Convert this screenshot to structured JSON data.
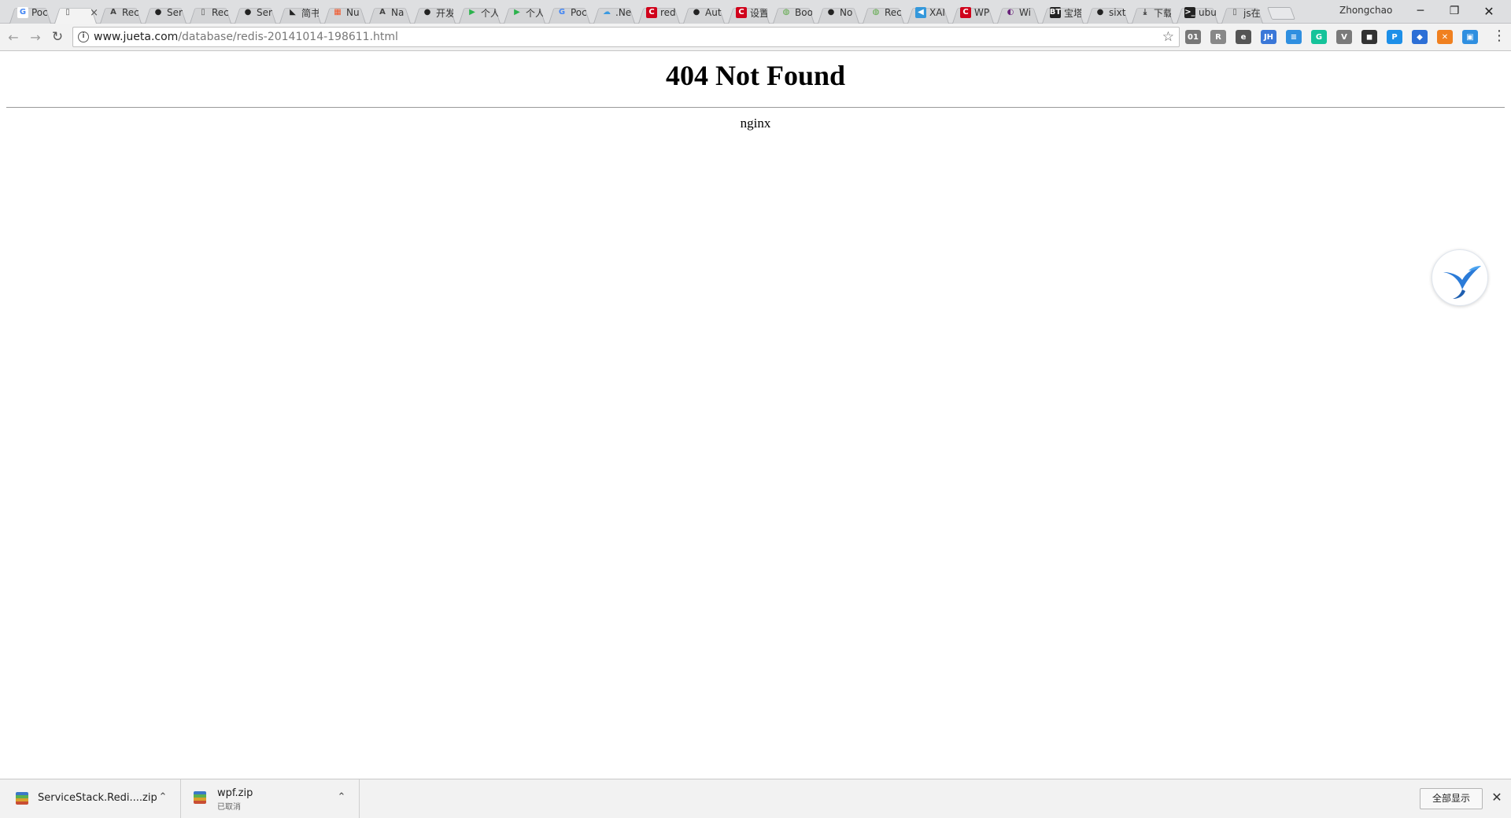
{
  "browser": {
    "tabs": [
      {
        "title": "Poc",
        "favicon": "google-icon",
        "fav_text": "G",
        "fav_color": "#ffffff",
        "fav_fg": "#4285f4",
        "active": false
      },
      {
        "title": "",
        "favicon": "page-icon",
        "fav_text": "▯",
        "fav_color": "transparent",
        "fav_fg": "#555555",
        "active": true,
        "close": "×"
      },
      {
        "title": "Rec",
        "favicon": "translate-icon",
        "fav_text": "A",
        "fav_color": "transparent",
        "fav_fg": "#444444",
        "active": false
      },
      {
        "title": "Ser",
        "favicon": "github-icon",
        "fav_text": "●",
        "fav_color": "transparent",
        "fav_fg": "#222222",
        "active": false
      },
      {
        "title": "Rec",
        "favicon": "page-icon",
        "fav_text": "▯",
        "fav_color": "transparent",
        "fav_fg": "#555555",
        "active": false
      },
      {
        "title": "Ser",
        "favicon": "github-icon",
        "fav_text": "●",
        "fav_color": "transparent",
        "fav_fg": "#222222",
        "active": false
      },
      {
        "title": "简书",
        "favicon": "jianshu-icon",
        "fav_text": "◣",
        "fav_color": "transparent",
        "fav_fg": "#222222",
        "active": false
      },
      {
        "title": "Nu",
        "favicon": "microsoft-icon",
        "fav_text": "▦",
        "fav_color": "transparent",
        "fav_fg": "#f35325",
        "active": false
      },
      {
        "title": "Na",
        "favicon": "translate-icon",
        "fav_text": "A",
        "fav_color": "transparent",
        "fav_fg": "#444444",
        "active": false
      },
      {
        "title": "开发",
        "favicon": "github-icon",
        "fav_text": "●",
        "fav_color": "transparent",
        "fav_fg": "#222222",
        "active": false
      },
      {
        "title": "个人",
        "favicon": "play-icon",
        "fav_text": "▶",
        "fav_color": "transparent",
        "fav_fg": "#2bb24c",
        "active": false
      },
      {
        "title": "个人",
        "favicon": "play-icon",
        "fav_text": "▶",
        "fav_color": "transparent",
        "fav_fg": "#2bb24c",
        "active": false
      },
      {
        "title": "Poc",
        "favicon": "google-icon",
        "fav_text": "G",
        "fav_color": "transparent",
        "fav_fg": "#4285f4",
        "active": false
      },
      {
        "title": ".Ne",
        "favicon": "cloud-icon",
        "fav_text": "☁",
        "fav_color": "transparent",
        "fav_fg": "#3b9ae1",
        "active": false
      },
      {
        "title": "red",
        "favicon": "csdn-icon",
        "fav_text": "C",
        "fav_color": "#d0021b",
        "fav_fg": "#ffffff",
        "active": false
      },
      {
        "title": "Aut",
        "favicon": "github-icon",
        "fav_text": "●",
        "fav_color": "transparent",
        "fav_fg": "#222222",
        "active": false
      },
      {
        "title": "设置",
        "favicon": "csdn-icon",
        "fav_text": "C",
        "fav_color": "#d0021b",
        "fav_fg": "#ffffff",
        "active": false
      },
      {
        "title": "Boo",
        "favicon": "chat-icon",
        "fav_text": "◍",
        "fav_color": "transparent",
        "fav_fg": "#5aa844",
        "active": false
      },
      {
        "title": "No",
        "favicon": "github-icon",
        "fav_text": "●",
        "fav_color": "transparent",
        "fav_fg": "#222222",
        "active": false
      },
      {
        "title": "Rec",
        "favicon": "chat-icon",
        "fav_text": "◍",
        "fav_color": "transparent",
        "fav_fg": "#5aa844",
        "active": false
      },
      {
        "title": "XAI",
        "favicon": "xamarin-icon",
        "fav_text": "◀",
        "fav_color": "#3498db",
        "fav_fg": "#ffffff",
        "active": false
      },
      {
        "title": "WP",
        "favicon": "csdn-icon",
        "fav_text": "C",
        "fav_color": "#d0021b",
        "fav_fg": "#ffffff",
        "active": false
      },
      {
        "title": "Wi",
        "favicon": "vs-icon",
        "fav_text": "◐",
        "fav_color": "transparent",
        "fav_fg": "#68217a",
        "active": false
      },
      {
        "title": "宝塔",
        "favicon": "bt-icon",
        "fav_text": "BT",
        "fav_color": "#222222",
        "fav_fg": "#ffffff",
        "active": false
      },
      {
        "title": "sixt",
        "favicon": "github-icon",
        "fav_text": "●",
        "fav_color": "transparent",
        "fav_fg": "#222222",
        "active": false
      },
      {
        "title": "下载",
        "favicon": "download-icon",
        "fav_text": "⤓",
        "fav_color": "transparent",
        "fav_fg": "#333333",
        "active": false
      },
      {
        "title": "ubu",
        "favicon": "terminal-icon",
        "fav_text": ">_",
        "fav_color": "#222222",
        "fav_fg": "#ffffff",
        "active": false
      },
      {
        "title": "js在",
        "favicon": "page-icon",
        "fav_text": "▯",
        "fav_color": "transparent",
        "fav_fg": "#555555",
        "active": false
      }
    ],
    "profile_name": "Zhongchao",
    "window": {
      "minimize": "─",
      "restore": "❐",
      "close": "✕"
    },
    "nav": {
      "back": "←",
      "forward": "→",
      "reload": "↻"
    },
    "address": {
      "domain": "www.jueta.com",
      "path": "/database/redis-20141014-198611.html",
      "star": "☆"
    },
    "extensions": [
      {
        "name": "ext-01-icon",
        "text": "01",
        "color": "#777777"
      },
      {
        "name": "ext-r-icon",
        "text": "R",
        "color": "#888888"
      },
      {
        "name": "ext-evernote-icon",
        "text": "e",
        "color": "#555555"
      },
      {
        "name": "ext-jh-icon",
        "text": "JH",
        "color": "#3a77d8"
      },
      {
        "name": "ext-note-icon",
        "text": "≡",
        "color": "#2f8fe0"
      },
      {
        "name": "ext-grammarly-icon",
        "text": "G",
        "color": "#15c39a"
      },
      {
        "name": "ext-vue-icon",
        "text": "V",
        "color": "#7a7a7a"
      },
      {
        "name": "ext-cat-icon",
        "text": "◼",
        "color": "#333333"
      },
      {
        "name": "ext-pin-icon",
        "text": "P",
        "color": "#1d8fe8"
      },
      {
        "name": "ext-diamond-icon",
        "text": "◆",
        "color": "#2d6fd6"
      },
      {
        "name": "ext-orange-icon",
        "text": "✕",
        "color": "#f0801f"
      },
      {
        "name": "ext-window-icon",
        "text": "▣",
        "color": "#2f8fe0"
      }
    ],
    "menu": "⋮"
  },
  "page": {
    "heading": "404 Not Found",
    "server": "nginx"
  },
  "downloads": {
    "items": [
      {
        "name": "ServiceStack.Redi....zip",
        "status": ""
      },
      {
        "name": "wpf.zip",
        "status": "已取消"
      }
    ],
    "chevron": "⌃",
    "show_all": "全部显示",
    "close": "✕"
  }
}
